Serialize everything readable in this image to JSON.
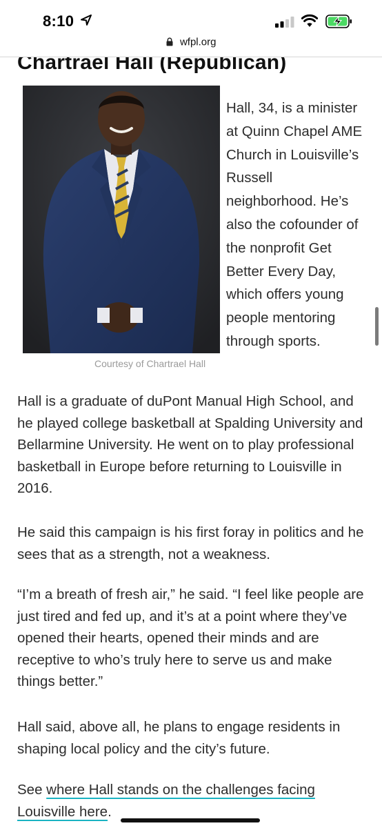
{
  "status": {
    "time": "8:10",
    "icons": [
      "location-arrow-icon",
      "cellular-signal-icon",
      "wifi-icon",
      "battery-charging-icon"
    ],
    "battery_color": "#4cd964"
  },
  "browser": {
    "url": "wfpl.org"
  },
  "article": {
    "heading": "Chartrael Hall (Republican)",
    "photo_caption": "Courtesy of Chartrael Hall",
    "side_text": "Hall, 34, is a minister at Quinn Chapel AME Church in Louisville’s Russell neighborhood. He’s also the cofounder of the nonprofit Get Better Every Day, which offers young people mentoring through sports.",
    "paragraphs": [
      "Hall is a graduate of duPont Manual High School, and he played college basketball at Spalding University and Bellarmine University. He went on to play professional basketball in Europe before returning to Louisville in 2016.",
      "He said this campaign is his first foray in politics and he sees that as a strength, not a weakness.",
      "“I’m a breath of fresh air,” he said. “I feel like people are just tired and fed up, and it’s at a point where they’ve opened their hearts, opened their minds and are receptive to who’s truly here to serve us and make things better.”",
      "Hall said, above all, he plans to engage residents in shaping local policy and the city’s future."
    ],
    "final_prefix": "See ",
    "final_link": "where Hall stands on the challenges facing Louisville here",
    "final_suffix": ".",
    "link_underline_color": "#19b3c2"
  }
}
